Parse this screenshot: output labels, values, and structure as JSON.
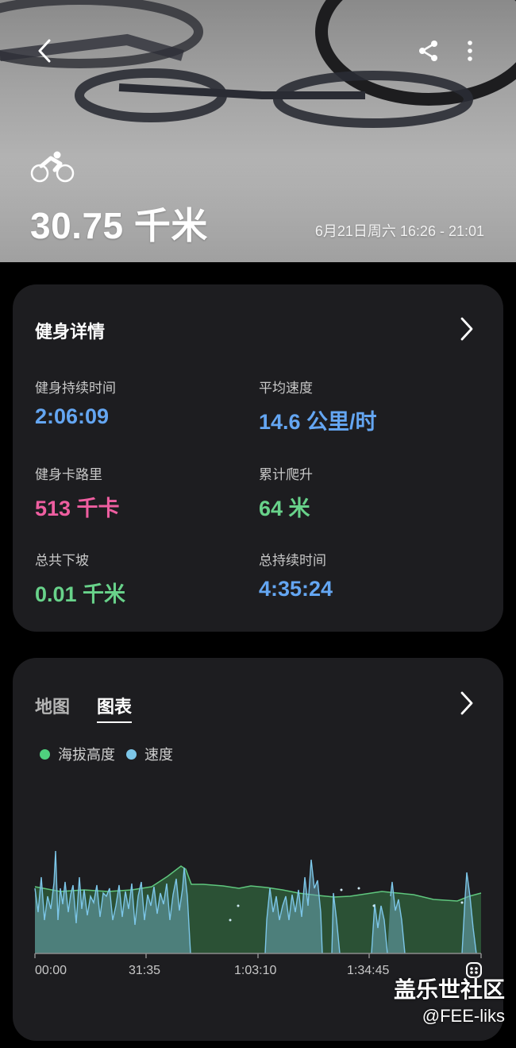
{
  "header": {
    "icons": {
      "back": "chevron-left-icon",
      "share": "share-icon",
      "more": "more-vertical-icon",
      "activity": "cycling-icon"
    },
    "distance": "30.75 千米",
    "datetime": "6月21日周六 16:26 - 21:01"
  },
  "details": {
    "title": "健身详情",
    "metrics": [
      {
        "label": "健身持续时间",
        "value": "2:06:09",
        "color": "#64a6f2"
      },
      {
        "label": "平均速度",
        "value": "14.6 公里/时",
        "color": "#64a6f2"
      },
      {
        "label": "健身卡路里",
        "value": "513 千卡",
        "color": "#ee5ea0"
      },
      {
        "label": "累计爬升",
        "value": "64 米",
        "color": "#68d28a"
      },
      {
        "label": "总共下坡",
        "value": "0.01 千米",
        "color": "#68d28a"
      },
      {
        "label": "总持续时间",
        "value": "4:35:24",
        "color": "#64a6f2"
      }
    ]
  },
  "chart_card": {
    "tabs": [
      {
        "label": "地图",
        "active": false
      },
      {
        "label": "图表",
        "active": true
      }
    ],
    "legend": [
      {
        "label": "海拔高度",
        "color": "#4fd17e"
      },
      {
        "label": "速度",
        "color": "#7cc6e8"
      }
    ]
  },
  "chart_data": {
    "type": "area",
    "x_tick_labels": [
      "00:00",
      "31:35",
      "1:03:10",
      "1:34:45"
    ],
    "series": [
      {
        "name": "海拔高度",
        "color": "#4fd17e"
      },
      {
        "name": "速度",
        "color": "#7cc6e8"
      }
    ],
    "grid": false,
    "legend_position": "top-left"
  },
  "watermark": {
    "line1": "盖乐世社区",
    "line2": "@FEE-liks"
  }
}
